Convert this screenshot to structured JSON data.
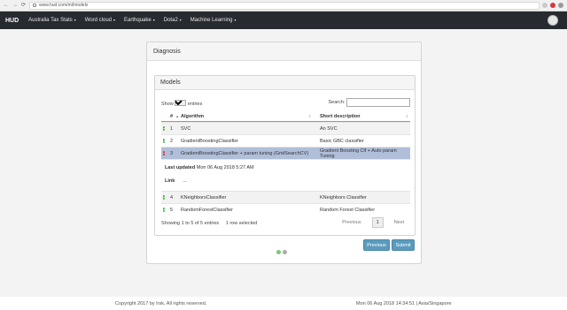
{
  "browser": {
    "url": "www.hud.com/ml/models",
    "nav_back": "←",
    "nav_forward": "→",
    "nav_reload": "⟳"
  },
  "navbar": {
    "brand": "HUD",
    "items": [
      {
        "label": "Australia Tax Stats"
      },
      {
        "label": "Word cloud"
      },
      {
        "label": "Earthquake"
      },
      {
        "label": "Dota2"
      },
      {
        "label": "Machine Learning"
      }
    ],
    "caret": "▾"
  },
  "panel": {
    "title": "Diagnosis",
    "models_title": "Models",
    "show_label": "Show",
    "entries_value": "10",
    "entries_label": "entries",
    "search_label": "Search:",
    "search_value": "",
    "columns": {
      "num": "#",
      "algorithm": "Algorithm",
      "description": "Short description"
    },
    "rows": [
      {
        "num": "1",
        "algorithm": "SVC",
        "description": "An SVC"
      },
      {
        "num": "2",
        "algorithm": "GradientBoostingClassifier",
        "description": "Basic GBC classifier"
      },
      {
        "num": "3",
        "algorithm": "GradientBoostingClassifier + param tuning (GridSearchCV)",
        "description": "Gradient Boosting Clf + Auto param Tuning"
      },
      {
        "num": "4",
        "algorithm": "KNeighborsClassifier",
        "description": "KNeighbors Classifier"
      },
      {
        "num": "5",
        "algorithm": "RandomForestClassifier",
        "description": "Random Forest Classifier"
      }
    ],
    "child": {
      "updated_label": "Last updated",
      "updated_value": "Mon 06 Aug 2018 5:27 AM",
      "link_label": "Link",
      "link_value": "..."
    },
    "info": "Showing 1 to 5 of 5 entries     1 row selected",
    "paging": {
      "previous": "Previous",
      "current": "1",
      "next": "Next"
    },
    "buttons": {
      "previous": "Previous",
      "submit": "Submit"
    }
  },
  "footer": {
    "copyright": "Copyright 2017 by Irsk. All rights reserved.",
    "datetime": "Mon 06 Aug 2018 14:34:51 | Asia/Singapore"
  },
  "colors": {
    "navbar": "#272b30",
    "selected_row": "#b0bed9",
    "button": "#5b9bbd",
    "expand": "#31b131",
    "collapse": "#d33333",
    "dot_active": "#7fc37f",
    "dot_inactive": "#aaaaaa"
  }
}
